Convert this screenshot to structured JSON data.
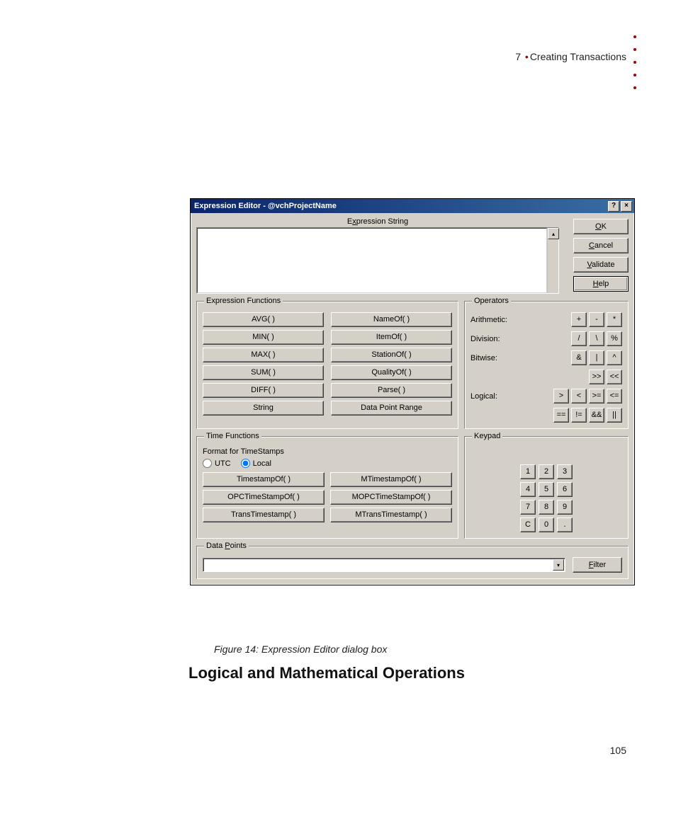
{
  "header": {
    "chapter_number": "7",
    "chapter_title": "Creating Transactions"
  },
  "dialog": {
    "title": "Expression Editor - @vchProjectName",
    "help_btn": "?",
    "close_btn": "×",
    "expression_string_label": "Expression String",
    "expression_value": "",
    "buttons": {
      "ok": "OK",
      "cancel": "Cancel",
      "validate": "Validate",
      "help": "Help"
    },
    "expression_functions": {
      "legend": "Expression Functions",
      "left": [
        "AVG( )",
        "MIN( )",
        "MAX( )",
        "SUM( )",
        "DIFF( )",
        "String"
      ],
      "right": [
        "NameOf( )",
        "ItemOf( )",
        "StationOf( )",
        "QualityOf( )",
        "Parse( )",
        "Data Point Range"
      ]
    },
    "operators": {
      "legend": "Operators",
      "rows": [
        {
          "label": "Arithmetic:",
          "ops": [
            "+",
            "-",
            "*"
          ]
        },
        {
          "label": "Division:",
          "ops": [
            "/",
            "\\",
            "%"
          ]
        },
        {
          "label": "Bitwise:",
          "ops": [
            "&",
            "|",
            "^"
          ]
        },
        {
          "label": "",
          "ops": [
            ">>",
            "<<"
          ]
        },
        {
          "label": "Logical:",
          "ops": [
            ">",
            "<",
            ">=",
            "<="
          ]
        },
        {
          "label": "",
          "ops": [
            "==",
            "!=",
            "&&",
            "||"
          ]
        }
      ]
    },
    "time_functions": {
      "legend": "Time Functions",
      "format_label": "Format for TimeStamps",
      "utc_label": "UTC",
      "local_label": "Local",
      "selected": "Local",
      "left": [
        "TimestampOf( )",
        "OPCTimeStampOf( )",
        "TransTimestamp( )"
      ],
      "right": [
        "MTimestampOf( )",
        "MOPCTimeStampOf( )",
        "MTransTimestamp( )"
      ]
    },
    "keypad": {
      "legend": "Keypad",
      "keys": [
        "1",
        "2",
        "3",
        "4",
        "5",
        "6",
        "7",
        "8",
        "9",
        "C",
        "0",
        "."
      ]
    },
    "data_points": {
      "legend": "Data Points",
      "value": "",
      "filter_btn": "Filter"
    }
  },
  "caption": "Figure 14: Expression Editor dialog box",
  "section_heading": "Logical and Mathematical Operations",
  "page_number": "105"
}
